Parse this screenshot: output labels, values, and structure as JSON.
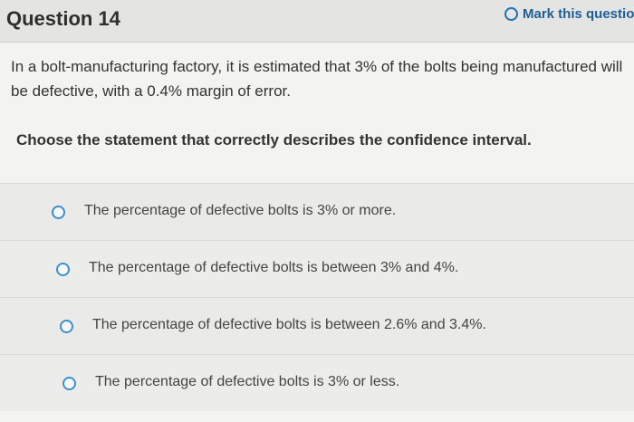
{
  "header": {
    "title": "Question 14",
    "mark_label": "Mark this question"
  },
  "question": {
    "text": "In a bolt-manufacturing factory, it is estimated that 3% of the bolts being manufactured will be defective, with a 0.4% margin of error.",
    "instruction": "Choose the statement that correctly describes the confidence interval."
  },
  "options": [
    {
      "label": "The percentage of defective bolts is 3% or more."
    },
    {
      "label": "The percentage of defective bolts is between 3% and 4%."
    },
    {
      "label": "The percentage of defective bolts is between 2.6% and 3.4%."
    },
    {
      "label": "The percentage of defective bolts is 3% or less."
    }
  ],
  "colors": {
    "accent": "#1f6fb5",
    "radio": "#3a8fd0"
  }
}
